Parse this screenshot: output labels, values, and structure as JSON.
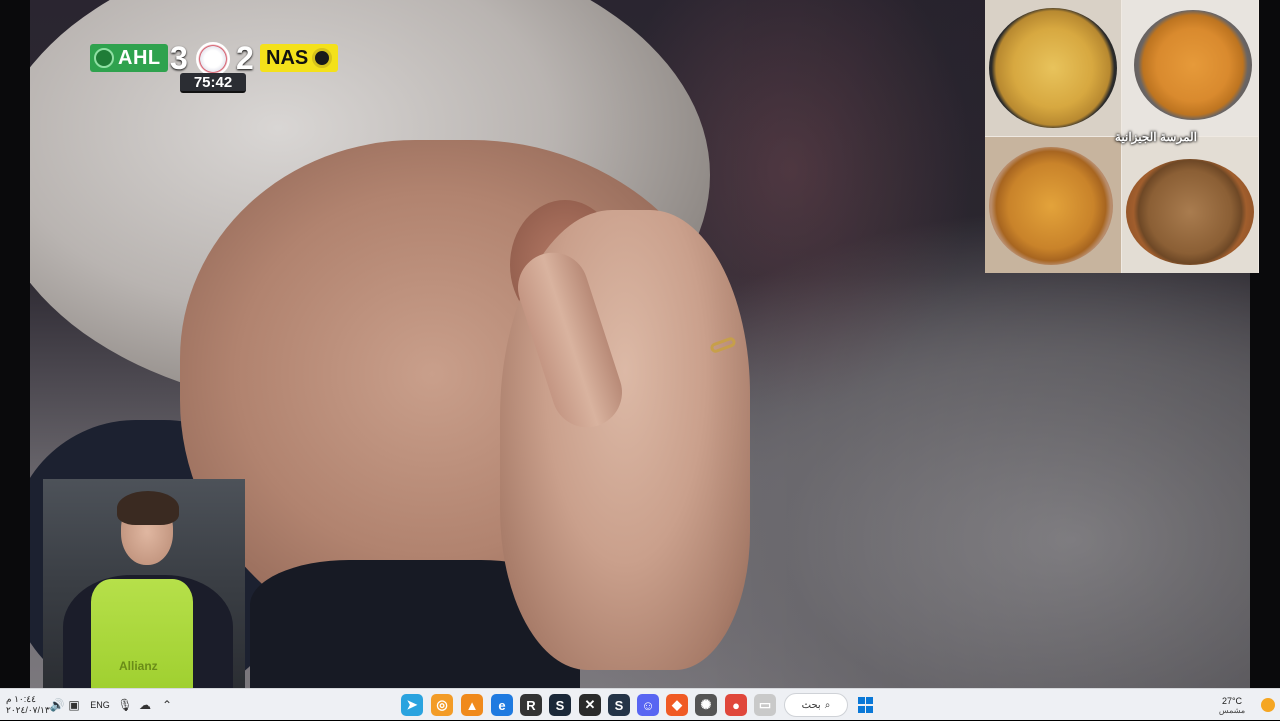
{
  "scoreboard": {
    "home_team": "AHL",
    "home_score": "3",
    "away_score": "2",
    "away_team": "NAS",
    "match_clock": "75:42",
    "home_color": "#2fa24e",
    "away_color": "#f4e11a"
  },
  "food_overlay": {
    "caption": "المرسة الجيزانية"
  },
  "player_inset": {
    "bib_text": "Allianz"
  },
  "taskbar": {
    "time": "١٠:٤٤ م",
    "date": "٢٠٢٤/٠٧/١٣",
    "language": "ENG",
    "search_label": "بحث",
    "weather_temp": "27°C",
    "weather_desc": "مشمس",
    "apps": [
      "telegram-icon",
      "overwatch-icon",
      "vlc-icon",
      "edge-icon",
      "rockstar-icon",
      "steam-icon",
      "xbox-icon",
      "steam-alt-icon",
      "discord-icon",
      "brave-icon",
      "steelseries-icon",
      "chrome-icon",
      "file-explorer-icon"
    ]
  }
}
